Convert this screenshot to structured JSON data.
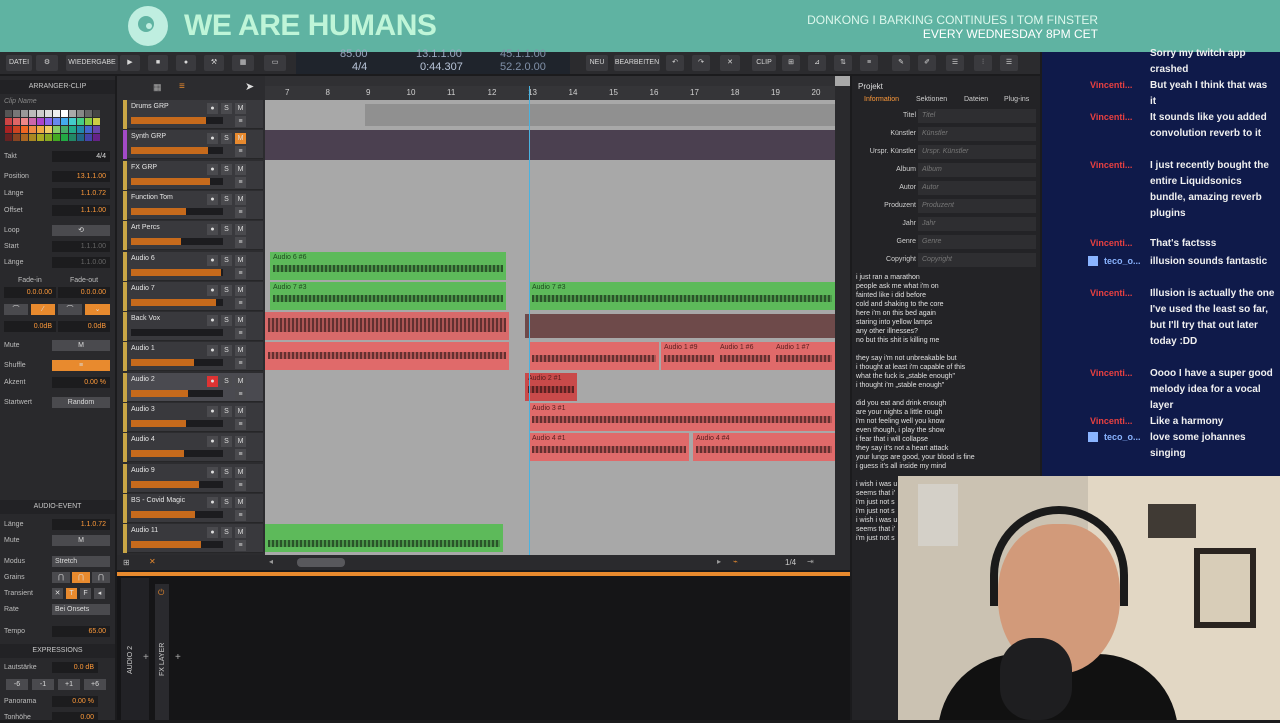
{
  "banner": {
    "brand": "WE ARE HUMANS",
    "line1": "DONKONG  I BARKING CONTINUES I TOM FINSTER",
    "line2": "EVERY WEDNESDAY 8PM CET"
  },
  "toolbar": {
    "datei": "DATEI",
    "wiedergabe": "WIEDERGABE",
    "neu": "NEU",
    "bearbeiten": "BEARBEITEN",
    "clip": "CLIP"
  },
  "transport": {
    "tempo": "85.00",
    "position": "13.1.1.00",
    "signature": "4/4",
    "time": "0:44.307",
    "loop_end": "45.1.1.00",
    "loop_len": "52.2.0.00"
  },
  "inspector": {
    "title": "ARRANGER-CLIP",
    "clip_name_placeholder": "Clip Name",
    "takt_label": "Takt",
    "takt": "4/4",
    "position_label": "Position",
    "position": "13.1.1.00",
    "laenge_label": "Länge",
    "laenge": "1.1.0.72",
    "offset_label": "Offset",
    "offset": "1.1.1.00",
    "loop_label": "Loop",
    "start_label": "Start",
    "start": "1.1.1.00",
    "loop_laenge": "1.1.0.00",
    "fadein_label": "Fade-in",
    "fadeout_label": "Fade-out",
    "fadein": "0.0.0.00",
    "fadeout": "0.0.0.00",
    "gain1": "0.0dB",
    "gain2": "0.0dB",
    "mute_label": "Mute",
    "mute": "M",
    "shuffle_label": "Shuffle",
    "akzent_label": "Akzent",
    "akzent": "0.00 %",
    "startwert_label": "Startwert",
    "startwert": "Random",
    "event_title": "AUDIO-EVENT",
    "ev_laenge_label": "Länge",
    "ev_laenge": "1.1.0.72",
    "ev_mute_label": "Mute",
    "ev_mute": "M",
    "modus_label": "Modus",
    "modus": "Stretch",
    "grains_label": "Grains",
    "transient_label": "Transient",
    "rate_label": "Rate",
    "rate": "Bei Onsets",
    "tempo_label": "Tempo",
    "tempo": "65.00",
    "expr_title": "EXPRESSIONS",
    "lautstaerke_label": "Lautstärke",
    "lautstaerke": "0.0 dB",
    "steps": [
      "-6",
      "-1",
      "+1",
      "+6"
    ],
    "panorama_label": "Panorama",
    "panorama": "0.00 %",
    "tonhoehe_label": "Tonhöhe",
    "tonhoehe": "0.00"
  },
  "ruler": [
    "7",
    "8",
    "9",
    "10",
    "11",
    "12",
    "13",
    "14",
    "15",
    "16",
    "17",
    "18",
    "19",
    "20"
  ],
  "tracks": [
    {
      "name": "Drums GRP",
      "color": "#c9a646",
      "level": 0.82
    },
    {
      "name": "Synth GRP",
      "color": "#a24ac7",
      "level": 0.84
    },
    {
      "name": "FX GRP",
      "color": "#c9a646",
      "level": 0.86
    },
    {
      "name": "Function Tom",
      "color": "#c9a646",
      "level": 0.6
    },
    {
      "name": "Art Percs",
      "color": "#c9a646",
      "level": 0.54
    },
    {
      "name": "Audio 6",
      "color": "#c9a646",
      "level": 0.98
    },
    {
      "name": "Audio 7",
      "color": "#c9a646",
      "level": 0.92
    },
    {
      "name": "Back Vox",
      "color": "#c9a646",
      "level": 0.0
    },
    {
      "name": "Audio 1",
      "color": "#c9a646",
      "level": 0.68
    },
    {
      "name": "Audio 2",
      "color": "#c9a646",
      "level": 0.62
    },
    {
      "name": "Audio 3",
      "color": "#c9a646",
      "level": 0.6
    },
    {
      "name": "Audio 4",
      "color": "#c9a646",
      "level": 0.58
    },
    {
      "name": "Audio 9",
      "color": "#c9a646",
      "level": 0.74
    },
    {
      "name": "BS - Covid Magic",
      "color": "#c9a646",
      "level": 0.7
    },
    {
      "name": "Audio 11",
      "color": "#c9a646",
      "level": 0.76
    }
  ],
  "clips": [
    {
      "label": "Audio 6 #6",
      "color": "green"
    },
    {
      "label": "Audio 7 #3",
      "color": "green"
    },
    {
      "label": "Audio 7 #3",
      "color": "green"
    },
    {
      "label": "Audio 1 #9",
      "color": "red"
    },
    {
      "label": "Audio 1 #6",
      "color": "red"
    },
    {
      "label": "Audio 1 #7",
      "color": "red"
    },
    {
      "label": "Audio 2 #1",
      "color": "red"
    },
    {
      "label": "Audio 3 #1",
      "color": "red"
    },
    {
      "label": "Audio 4 #1",
      "color": "red"
    },
    {
      "label": "Audio 4 #4",
      "color": "red"
    }
  ],
  "footer": {
    "zoom": "1/4"
  },
  "bottom": {
    "track_label": "AUDIO 2",
    "layer_label": "FX LAYER"
  },
  "panel": {
    "title": "Projekt",
    "tabs": [
      "Information",
      "Sektionen",
      "Dateien",
      "Plug-ins"
    ],
    "meta": [
      [
        "Titel",
        "Titel"
      ],
      [
        "Künstler",
        "Künstler"
      ],
      [
        "Urspr. Künstler",
        "Urspr. Künstler"
      ],
      [
        "Album",
        "Album"
      ],
      [
        "Autor",
        "Autor"
      ],
      [
        "Produzent",
        "Produzent"
      ],
      [
        "Jahr",
        "Jahr"
      ],
      [
        "Genre",
        "Genre"
      ],
      [
        "Copyright",
        "Copyright"
      ]
    ],
    "lyrics": "i just ran a marathon\npeople ask me what i'm on\nfainted like i did before\ncold and shaking to the core\nhere i'm on this bed again\nstaring into yellow lamps\nany other illnesses?\nno but this shit is killing me\n\nthey say i'm not unbreakable but\ni thought at least i'm capable of this\nwhat the fuck is „stable enough\"\ni thought i'm „stable enough\"\n\ndid you eat and drink enough\nare your nights a little rough\ni'm not feeling well you know\neven though, i play the show\ni fear that i will collapse\nthey say it's not a heart attack\nyour lungs are good, your blood is fine\ni guess it's all inside my mind\n\ni wish i was u\nseems that i'\ni'm just not s\ni'm just not s\ni wish i was u\nseems that i'\ni'm just not s"
  },
  "chat": [
    {
      "user": "",
      "text": "Sorry my twitch app crashed"
    },
    {
      "user": "Vincenti...",
      "text": "But yeah I think that was it"
    },
    {
      "user": "Vincenti...",
      "text": "It sounds like you added convolution reverb to it"
    },
    {
      "user": "Vincenti...",
      "text": "I just recently bought the entire Liquidsonics bundle, amazing reverb plugins"
    },
    {
      "user": "Vincenti...",
      "text": "That's factsss"
    },
    {
      "user": "teco_o...",
      "text": "illusion sounds fantastic"
    },
    {
      "user": "Vincenti...",
      "text": "Illusion is actually the one I've used the least so far, but I'll try that out later today :DD"
    },
    {
      "user": "Vincenti...",
      "text": "Oooo I have a super good melody idea for a vocal layer"
    },
    {
      "user": "Vincenti...",
      "text": "Like a harmony"
    },
    {
      "user": "teco_o...",
      "text": "love some johannes singing"
    }
  ]
}
